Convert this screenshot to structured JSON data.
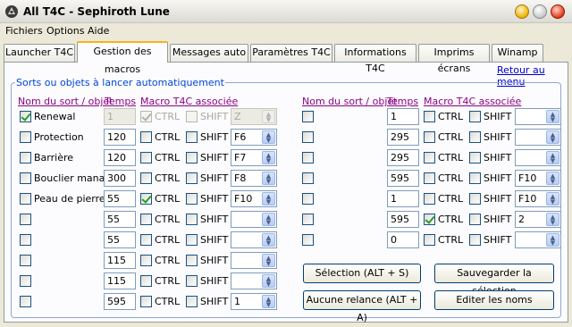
{
  "window": {
    "title": "All T4C - Sephiroth Lune"
  },
  "menu": [
    "Fichiers",
    "Options",
    "Aide"
  ],
  "tabs": [
    "Launcher T4C",
    "Gestion des macros",
    "Messages auto",
    "Paramètres T4C",
    "Informations T4C",
    "Imprims écrans",
    "Winamp"
  ],
  "panel": {
    "return_link": "Retour au menu",
    "group_title": "Sorts ou objets à lancer automatiquement",
    "headers": {
      "name": "Nom du sort / objet",
      "time": "Temps",
      "macro": "Macro T4C associée"
    },
    "ctrl_label": "CTRL",
    "shift_label": "SHIFT",
    "buttons": {
      "select": "Sélection (ALT + S)",
      "save": "Sauvegarder la sélection",
      "none": "Aucune relance (ALT + A)",
      "edit": "Editer les noms"
    }
  },
  "left_rows": [
    {
      "name": "Renewal",
      "checked": true,
      "time": "1",
      "ctrl": true,
      "shift": false,
      "key": "Z",
      "disabled": true
    },
    {
      "name": "Protection",
      "checked": false,
      "time": "120",
      "ctrl": false,
      "shift": false,
      "key": "F6",
      "disabled": false
    },
    {
      "name": "Barrière",
      "checked": false,
      "time": "120",
      "ctrl": false,
      "shift": false,
      "key": "F7",
      "disabled": false
    },
    {
      "name": "Bouclier mana",
      "checked": false,
      "time": "300",
      "ctrl": false,
      "shift": false,
      "key": "F8",
      "disabled": false
    },
    {
      "name": "Peau de pierre",
      "checked": false,
      "time": "55",
      "ctrl": true,
      "shift": false,
      "key": "F10",
      "disabled": false
    },
    {
      "name": "",
      "checked": false,
      "time": "55",
      "ctrl": false,
      "shift": false,
      "key": "",
      "disabled": false
    },
    {
      "name": "",
      "checked": false,
      "time": "55",
      "ctrl": false,
      "shift": false,
      "key": "",
      "disabled": false
    },
    {
      "name": "",
      "checked": false,
      "time": "115",
      "ctrl": false,
      "shift": false,
      "key": "",
      "disabled": false
    },
    {
      "name": "",
      "checked": false,
      "time": "115",
      "ctrl": false,
      "shift": false,
      "key": "",
      "disabled": false
    },
    {
      "name": "",
      "checked": false,
      "time": "595",
      "ctrl": false,
      "shift": false,
      "key": "1",
      "disabled": false
    }
  ],
  "right_rows": [
    {
      "name": "",
      "checked": false,
      "time": "1",
      "ctrl": false,
      "shift": false,
      "key": ""
    },
    {
      "name": "",
      "checked": false,
      "time": "295",
      "ctrl": false,
      "shift": false,
      "key": ""
    },
    {
      "name": "",
      "checked": false,
      "time": "295",
      "ctrl": false,
      "shift": false,
      "key": ""
    },
    {
      "name": "",
      "checked": false,
      "time": "595",
      "ctrl": false,
      "shift": false,
      "key": "F10"
    },
    {
      "name": "",
      "checked": false,
      "time": "1",
      "ctrl": false,
      "shift": false,
      "key": "F10"
    },
    {
      "name": "",
      "checked": false,
      "time": "595",
      "ctrl": true,
      "shift": false,
      "key": "2"
    },
    {
      "name": "",
      "checked": false,
      "time": "0",
      "ctrl": false,
      "shift": false,
      "key": ""
    }
  ]
}
